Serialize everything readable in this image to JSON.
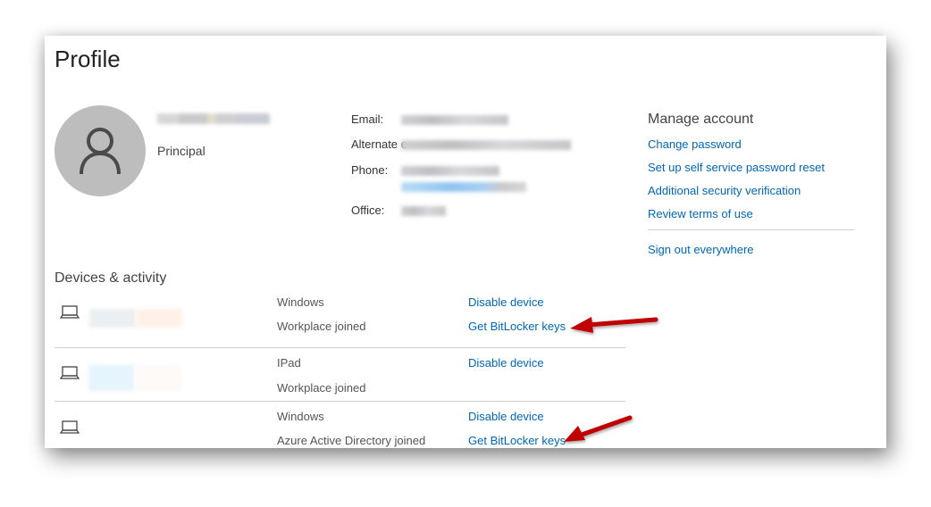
{
  "page": {
    "title": "Profile"
  },
  "profile": {
    "avatar_icon": "person-icon",
    "name": "(redacted)",
    "role": "Principal",
    "fields": [
      {
        "label": "Email:",
        "value": "(redacted)"
      },
      {
        "label": "Alternate e",
        "value": "(redacted)"
      },
      {
        "label": "Phone:",
        "value": "(redacted)",
        "value2": "(redacted)"
      },
      {
        "label": "Office:",
        "value": "(redacted)"
      }
    ]
  },
  "manage_account": {
    "heading": "Manage account",
    "links": [
      "Change password",
      "Set up self service password reset",
      "Additional security verification",
      "Review terms of use"
    ],
    "sign_out": "Sign out everywhere"
  },
  "devices": {
    "heading": "Devices & activity",
    "items": [
      {
        "icon": "laptop-icon",
        "name": "(redacted)",
        "os": "Windows",
        "join_type": "Workplace joined",
        "actions": [
          "Disable device",
          "Get BitLocker keys"
        ]
      },
      {
        "icon": "laptop-icon",
        "name": "(redacted)",
        "os": "IPad",
        "join_type": "Workplace joined",
        "actions": [
          "Disable device"
        ]
      },
      {
        "icon": "laptop-icon",
        "name": "",
        "os": "Windows",
        "join_type": "Azure Active Directory joined",
        "actions": [
          "Disable device",
          "Get BitLocker keys"
        ]
      }
    ]
  },
  "annotations": {
    "arrow_color": "#c00000"
  },
  "colors": {
    "link": "#0067b8",
    "avatar_bg": "#bdbdbd"
  }
}
